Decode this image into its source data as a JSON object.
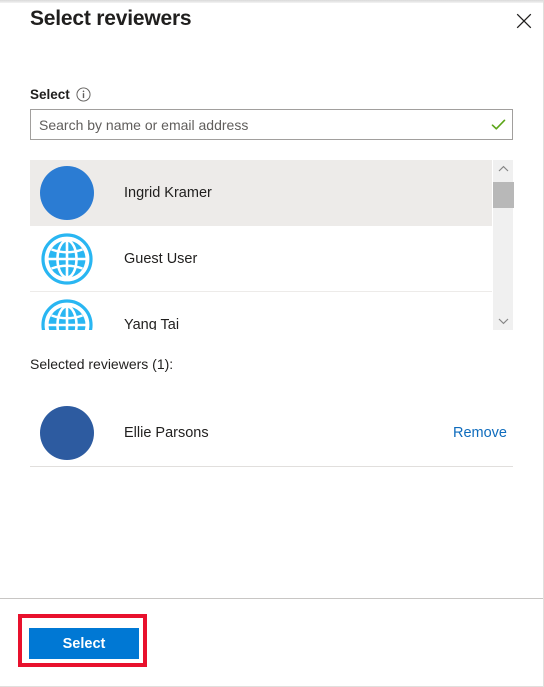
{
  "dialog": {
    "title": "Select reviewers",
    "close_icon": "close-icon"
  },
  "field": {
    "label": "Select",
    "info_icon": "info-icon"
  },
  "search": {
    "placeholder": "Search by name or email address",
    "value": "",
    "valid_icon": "checkmark-icon",
    "valid_icon_color": "#5ba517"
  },
  "results": {
    "scrollbar": {
      "up_icon": "chevron-up-icon",
      "down_icon": "chevron-down-icon"
    },
    "items": [
      {
        "name": "Ingrid Kramer",
        "avatar_type": "solid-blue",
        "avatar_color": "#2b7cd3",
        "highlighted": true
      },
      {
        "name": "Guest User",
        "avatar_type": "globe",
        "avatar_color": "#29b6f2",
        "highlighted": false
      },
      {
        "name": "Yang Tai",
        "avatar_type": "globe",
        "avatar_color": "#29b6f2",
        "highlighted": false
      }
    ]
  },
  "selected": {
    "heading": "Selected reviewers (1):",
    "count": 1,
    "items": [
      {
        "name": "Ellie Parsons",
        "avatar_type": "solid-navy",
        "avatar_color": "#2d5ba0",
        "remove_label": "Remove"
      }
    ]
  },
  "footer": {
    "select_label": "Select",
    "select_color": "#0078d4",
    "highlight_color": "#e8112d"
  }
}
